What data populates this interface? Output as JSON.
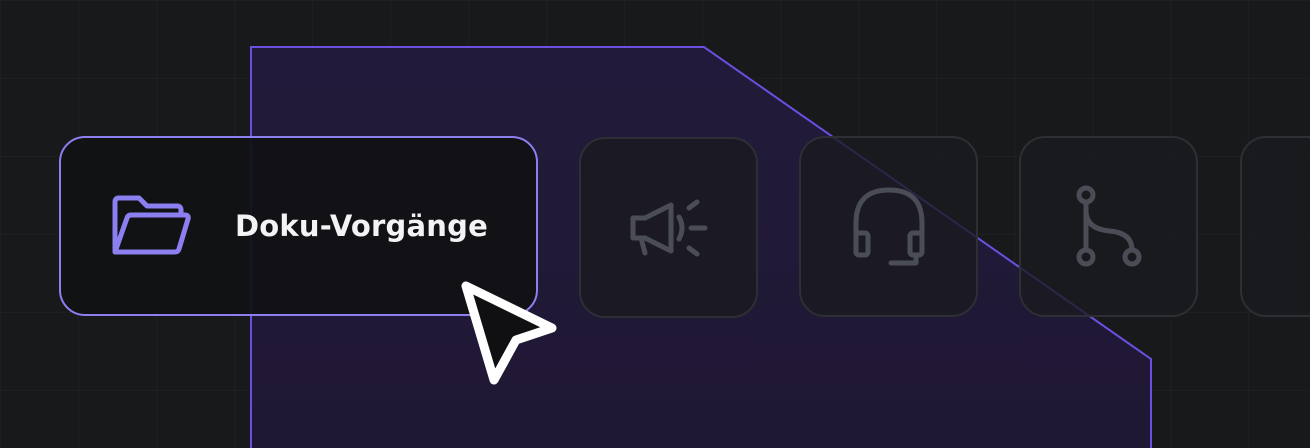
{
  "toolbar": {
    "active_item": {
      "label": "Doku-Vorgänge",
      "icon": "folder-open-icon",
      "accent_color": "#8c7ff0"
    },
    "items": [
      {
        "icon": "megaphone-icon"
      },
      {
        "icon": "headset-icon"
      },
      {
        "icon": "git-branch-icon"
      },
      {
        "icon": "partial-tile"
      }
    ],
    "inactive_icon_color": "#4b4d56",
    "highlight_border_color": "#6a4fe0"
  },
  "cursor": {
    "icon": "cursor-arrow-icon"
  }
}
